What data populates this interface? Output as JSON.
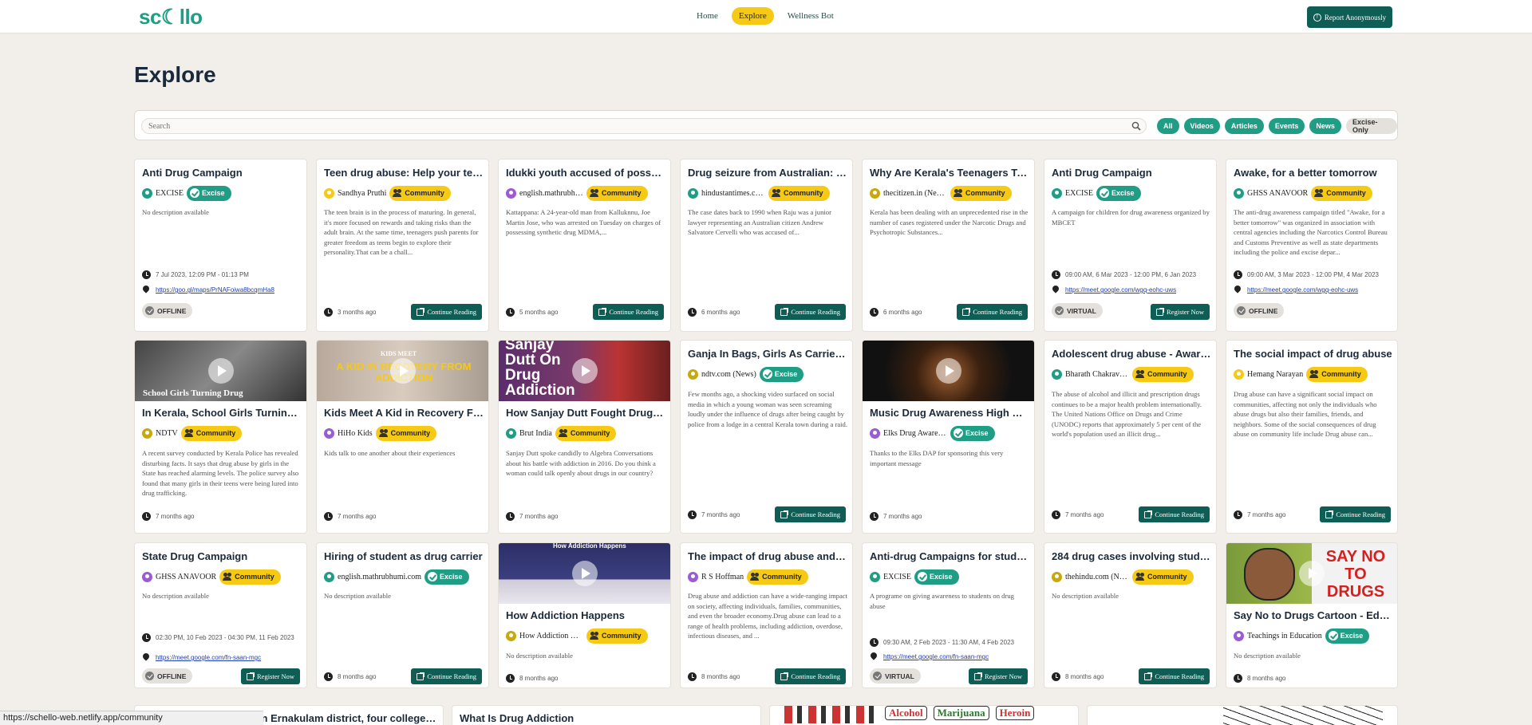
{
  "header": {
    "logo": "sc☾llo",
    "nav": [
      "Home",
      "Explore",
      "Wellness Bot"
    ],
    "report_label": "Report Anonymously"
  },
  "page": {
    "title": "Explore"
  },
  "search": {
    "placeholder": "Search",
    "filters": [
      "All",
      "Videos",
      "Articles",
      "Events",
      "News",
      "Excise-Only"
    ]
  },
  "row1": [
    {
      "title": "Anti Drug Campaign",
      "source": "EXCISE",
      "badge": "Excise",
      "desc": "No description available",
      "time": "7 Jul 2023, 12:09 PM   - 01:13 PM",
      "link": "https://goo.gl/maps/PrNAFoiwa8bcqmHa8",
      "mode": "OFFLINE"
    },
    {
      "title": "Teen drug abuse: Help your teen avoid drugs",
      "source": "Sandhya Pruthi",
      "badge": "Community",
      "desc": "The teen brain is in the process of maturing. In general, it's more focused on rewards and taking risks than the adult brain. At the same time, teenagers push parents for greater freedom as teens begin to explore their personality.That can be a chall...",
      "time": "3 months ago",
      "button": "Continue Reading"
    },
    {
      "title": "Idukki youth accused of possessing drugs",
      "source": "english.mathrubhumi.com",
      "badge": "Community",
      "desc": "Kattappana: A 24-year-old man from Kalluknnu, Joe Martin Jose, who was arrested on Tuesday on charges of possessing synthetic drug MDMA,...",
      "time": "5 months ago",
      "button": "Continue Reading"
    },
    {
      "title": "Drug seizure from Australian: Kerala lawyer",
      "source": "hindustantimes.com",
      "badge": "Community",
      "desc": "The case dates back to 1990 when Raju was a junior lawyer representing an Australian citizen Andrew Salvatore Cervelli who was accused of...",
      "time": "6 months ago",
      "button": "Continue Reading"
    },
    {
      "title": "Why Are Kerala's Teenagers Turning to Drugs",
      "source": "thecitizen.in (News)",
      "badge": "Community",
      "desc": "Kerala has been dealing with an unprecedented rise in the number of cases registered under the Narcotic Drugs and Psychotropic Substances...",
      "time": "6 months ago",
      "button": "Continue Reading"
    },
    {
      "title": "Anti Drug Campaign",
      "source": "EXCISE",
      "badge": "Excise",
      "desc": "A campaign for children for drug awareness organized by MBCET",
      "time": "09:00 AM, 6 Mar 2023   - 12:00 PM, 6 Jan 2023",
      "link": "https://meet.google.com/wgq-eohc-uws",
      "mode": "VIRTUAL",
      "button": "Register Now"
    },
    {
      "title": "Awake, for a better tomorrow",
      "source": "GHSS ANAVOOR",
      "badge": "Community",
      "desc": "The anti-drug awareness campaign titled \"Awake, for a better tomorrow\" was organized in association with central agencies including the Narcotics Control Bureau and Customs Preventive as well as state departments including the police and excise depar...",
      "time": "09:00 AM, 3 Mar 2023   - 12:00 PM, 4 Mar 2023",
      "link": "https://meet.google.com/wgq-eohc-uws",
      "mode": "OFFLINE"
    }
  ],
  "row2": [
    {
      "title": "In Kerala, School Girls Turning Drug Carriers",
      "source": "NDTV",
      "badge": "Community",
      "desc": "A recent survey conducted by Kerala Police has revealed disturbing facts. It says that drug abuse by girls in the State has reached alarming levels. The police survey also found that many girls in their teens were being lured into drug trafficking.",
      "time": "7 months ago",
      "thumb_text": "School Girls Turning Drug"
    },
    {
      "title": "Kids Meet A Kid in Recovery From Addiction",
      "source": "HiHo Kids",
      "badge": "Community",
      "desc": "Kids talk to one another about their experiences",
      "time": "7 months ago",
      "thumb_text": "A KID IN RECOVERY FROM ADDICTION",
      "thumb_small": "KIDS MEET"
    },
    {
      "title": "How Sanjay Dutt Fought Drug Addiction",
      "source": "Brut India",
      "badge": "Community",
      "desc": "Sanjay Dutt spoke candidly to Algebra Conversations about his battle with addiction in 2016. Do you think a woman could talk openly about drugs in our country?",
      "time": "7 months ago",
      "thumb_text": "Sanjay Dutt On Drug Addiction"
    },
    {
      "title": "Ganja In Bags, Girls As Carriers: Kerala Drug Racket",
      "source": "ndtv.com (News)",
      "badge": "Excise",
      "desc": "Few months ago, a shocking video surfaced on social media in which a young woman was seen screaming loudly under the influence of drugs after being caught by police from a lodge in a central Kerala town during a raid.",
      "time": "7 months ago",
      "button": "Continue Reading"
    },
    {
      "title": "Music Drug Awareness High School",
      "source": "Elks Drug Awareness Program",
      "badge": "Excise",
      "desc": "Thanks to the Elks DAP for sponsoring this very important message",
      "time": "7 months ago"
    },
    {
      "title": "Adolescent drug abuse - Awareness and prevention",
      "source": "Bharath Chakravarthy",
      "badge": "Community",
      "desc": "The abuse of alcohol and illicit and prescription drugs continues to be a major health problem internationally. The United Nations Office on Drugs and Crime (UNODC) reports that approximately 5 per cent of the world's population used an illicit drug...",
      "time": "7 months ago",
      "button": "Continue Reading"
    },
    {
      "title": "The social impact of drug abuse",
      "source": "Hemang Narayan",
      "badge": "Community",
      "desc": "Drug abuse can have a significant social impact on communities, affecting not only the individuals who abuse drugs but also their families, friends, and neighbors. Some of the social consequences of drug abuse on community life include Drug abuse can...",
      "time": "7 months ago",
      "button": "Continue Reading"
    }
  ],
  "row3": [
    {
      "title": "State Drug Campaign",
      "source": "GHSS ANAVOOR",
      "badge": "Community",
      "desc": "No description available",
      "time": "02:30 PM, 10 Feb 2023   - 04:30 PM, 11 Feb 2023",
      "link": "https://meet.google.com/fn-saan-mgc",
      "mode": "OFFLINE",
      "button": "Register Now"
    },
    {
      "title": "Hiring of student as drug carrier",
      "source": "english.mathrubhumi.com",
      "badge": "Excise",
      "desc": "No description available",
      "time": "8 months ago",
      "button": "Continue Reading"
    },
    {
      "title": "How Addiction Happens",
      "source": "How Addiction Happens",
      "badge": "Community",
      "desc": "No description available",
      "time": "8 months ago",
      "thumb_text": "How Addiction Happens"
    },
    {
      "title": "The impact of drug abuse and addiction on society",
      "source": "R S Hoffman",
      "badge": "Community",
      "desc": "Drug abuse and addiction can have a wide-ranging impact on society, affecting individuals, families, communities, and even the broader economy.Drug abuse can lead to a range of health problems, including addiction, overdose, infectious diseases, and ...",
      "time": "8 months ago",
      "button": "Continue Reading"
    },
    {
      "title": "Anti-drug Campaigns for students",
      "source": "EXCISE",
      "badge": "Excise",
      "desc": "A programe on giving awareness to students on drug abuse",
      "time": "09:30 AM, 2 Feb 2023   - 11:30 AM, 4 Feb 2023",
      "link": "https://meet.google.com/fn-saan-mgc",
      "mode": "VIRTUAL",
      "button": "Register Now"
    },
    {
      "title": "284 drug cases involving students",
      "source": "thehindu.com (News)",
      "badge": "Community",
      "desc": "No description available",
      "time": "8 months ago",
      "button": "Continue Reading"
    },
    {
      "title": "Say No to Drugs Cartoon - Educational Video",
      "source": "Teachings in Education",
      "badge": "Excise",
      "desc": "No description available",
      "time": "8 months ago",
      "thumb_text": "SAY NO TO DRUGS"
    }
  ],
  "row4": [
    {
      "title": "Hours to Kerala school in Ernakulam district, four college students arrested"
    },
    {
      "title": "What Is Drug Addiction"
    },
    {
      "thumb_labels": [
        "Alcohol",
        "Marijuana",
        "Heroin"
      ]
    },
    {
      "title": ""
    }
  ],
  "statusbar": {
    "url": "https://schello-web.netlify.app/community"
  },
  "colors": {
    "accent": "#1f9e85",
    "community": "#f6c915",
    "button": "#0f5e56"
  }
}
